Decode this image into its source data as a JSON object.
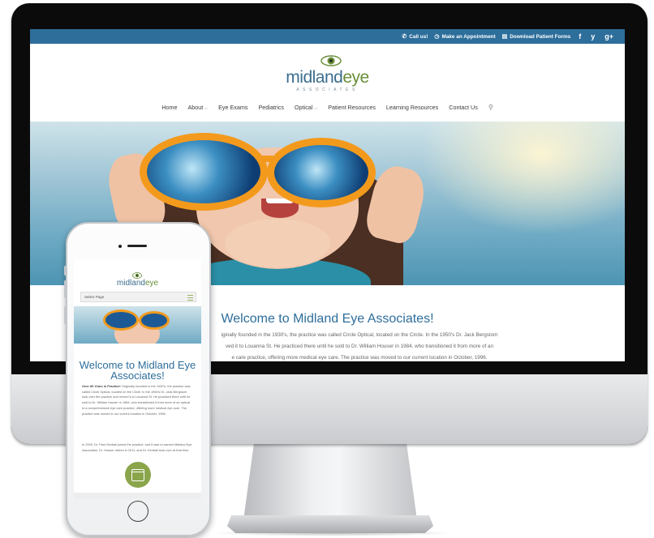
{
  "topbar": {
    "call": "Call us!",
    "appointment": "Make an Appointment",
    "forms": "Download Patient Forms",
    "social": [
      "f",
      "y",
      "g+"
    ]
  },
  "logo": {
    "word_a": "midland",
    "word_b": "eye",
    "sub": "ASSOCIATES"
  },
  "nav": [
    "Home",
    "About",
    "Eye Exams",
    "Pediatrics",
    "Optical",
    "Patient Resources",
    "Learning Resources",
    "Contact Us"
  ],
  "main": {
    "title": "Welcome to Midland Eye Associates!",
    "intro": [
      "iginally founded in the 1930's, the practice was called Circle Optical, located on the Circle. In the 1950's Dr. Jack Bergstom",
      "ved it to Louanna St. He practiced there until he sold to Dr. William Houser in 1984, who transitioned it from more of an",
      "e care practice, offering more medical eye care. The practice was moved to our current location in October, 1996."
    ]
  },
  "mobile": {
    "logo_a": "midland",
    "logo_b": "eye",
    "select_label": "Select Page",
    "title": "Welcome to Midland Eye Associates!",
    "para1_bold": "Over 80 Years in Practice!",
    "para1": " Originally founded in the 1930's, the practice was called Circle Optical, located on the Circle. In the 1950's Dr. Jack Bergstom took over the practice and moved it to Louanna St. He practiced there until he sold to Dr. William Houser in 1984, who transitioned it from more of an optical to a comprehensive eye care practice, offering more medical eye care. The practice was moved to our current location in October, 1996.",
    "para2": "In 2009, Dr. Paul Kimball joined the practice, and it was re-named Midland Eye Associates. Dr. Houser retired in 2011, and Dr. Kimball took over at that time."
  },
  "colors": {
    "brand_blue": "#2d6e9b",
    "brand_green": "#6a8f3a",
    "glasses_orange": "#f39a1d"
  }
}
